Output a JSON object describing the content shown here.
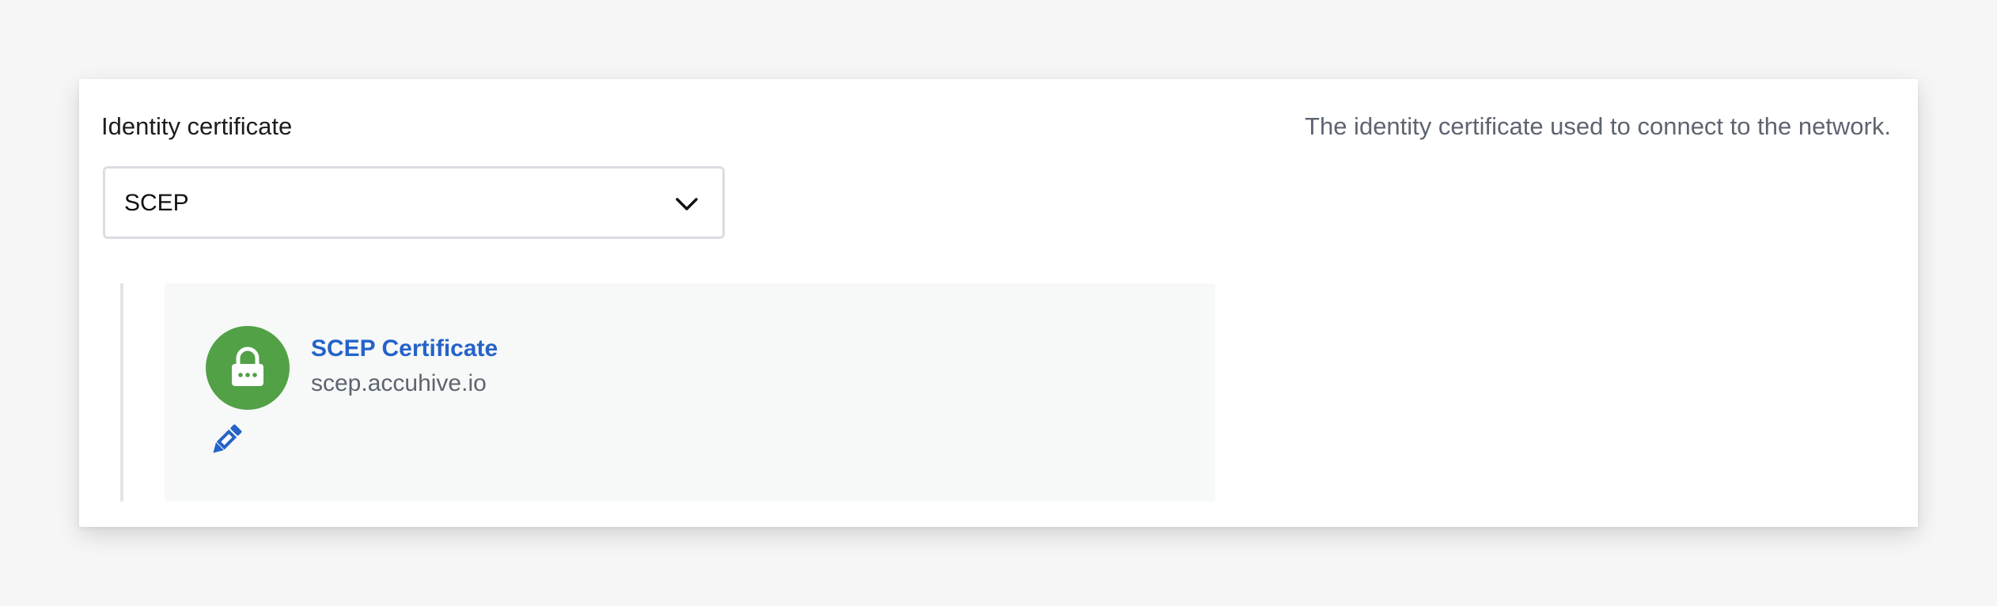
{
  "field": {
    "label": "Identity certificate",
    "help_text": "The identity certificate used to connect to the network."
  },
  "select": {
    "selected_value": "SCEP"
  },
  "certificate": {
    "title": "SCEP Certificate",
    "host": "scep.accuhive.io",
    "icon": "lock-icon",
    "badge_color": "#52a147"
  },
  "actions": {
    "edit_icon": "pencil-icon",
    "accent_color": "#2563c9"
  }
}
